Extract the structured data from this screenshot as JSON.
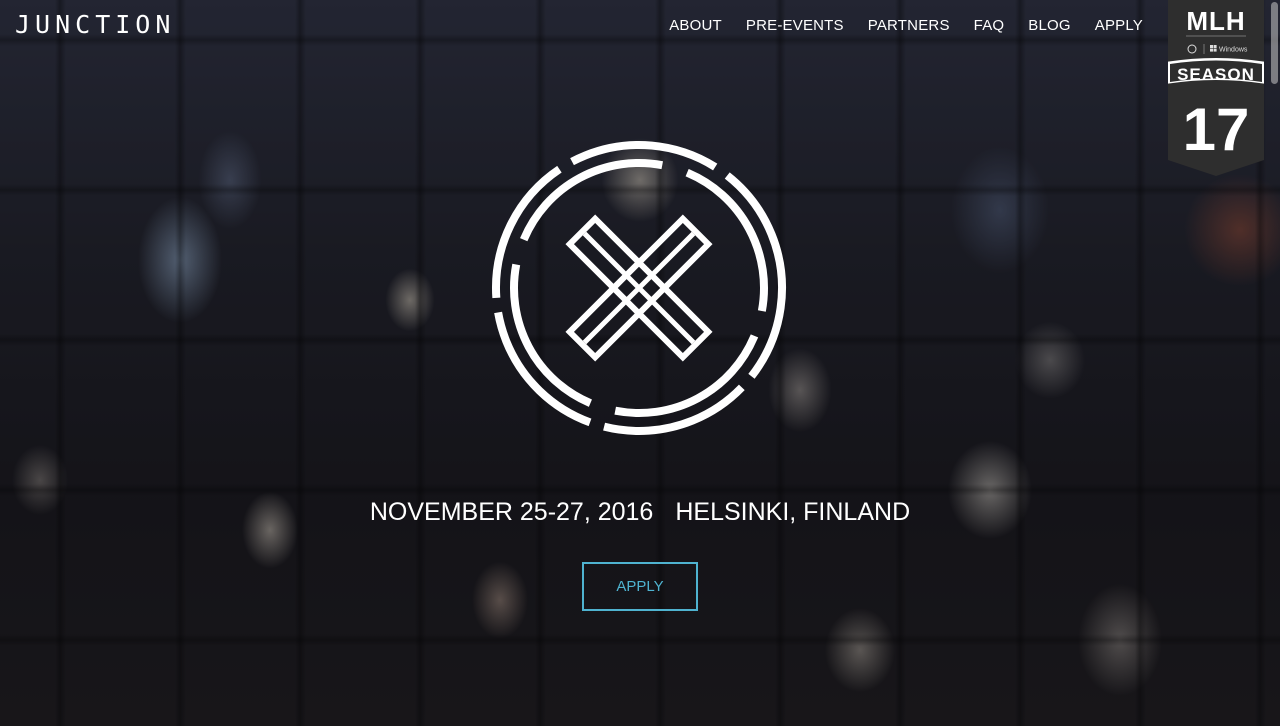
{
  "header": {
    "brand": "JUNCTION",
    "nav": [
      {
        "label": "ABOUT"
      },
      {
        "label": "PRE-EVENTS"
      },
      {
        "label": "PARTNERS"
      },
      {
        "label": "FAQ"
      },
      {
        "label": "BLOG"
      },
      {
        "label": "APPLY"
      }
    ]
  },
  "badge": {
    "org": "MLH",
    "sponsor": "Windows",
    "season_label": "SEASON",
    "season_number": "17"
  },
  "hero": {
    "date": "NOVEMBER 25-27, 2016",
    "location": "HELSINKI, FINLAND",
    "cta_label": "APPLY"
  },
  "colors": {
    "accent": "#4fb3d0",
    "text": "#ffffff",
    "badge_bg": "#2e2e2e"
  }
}
